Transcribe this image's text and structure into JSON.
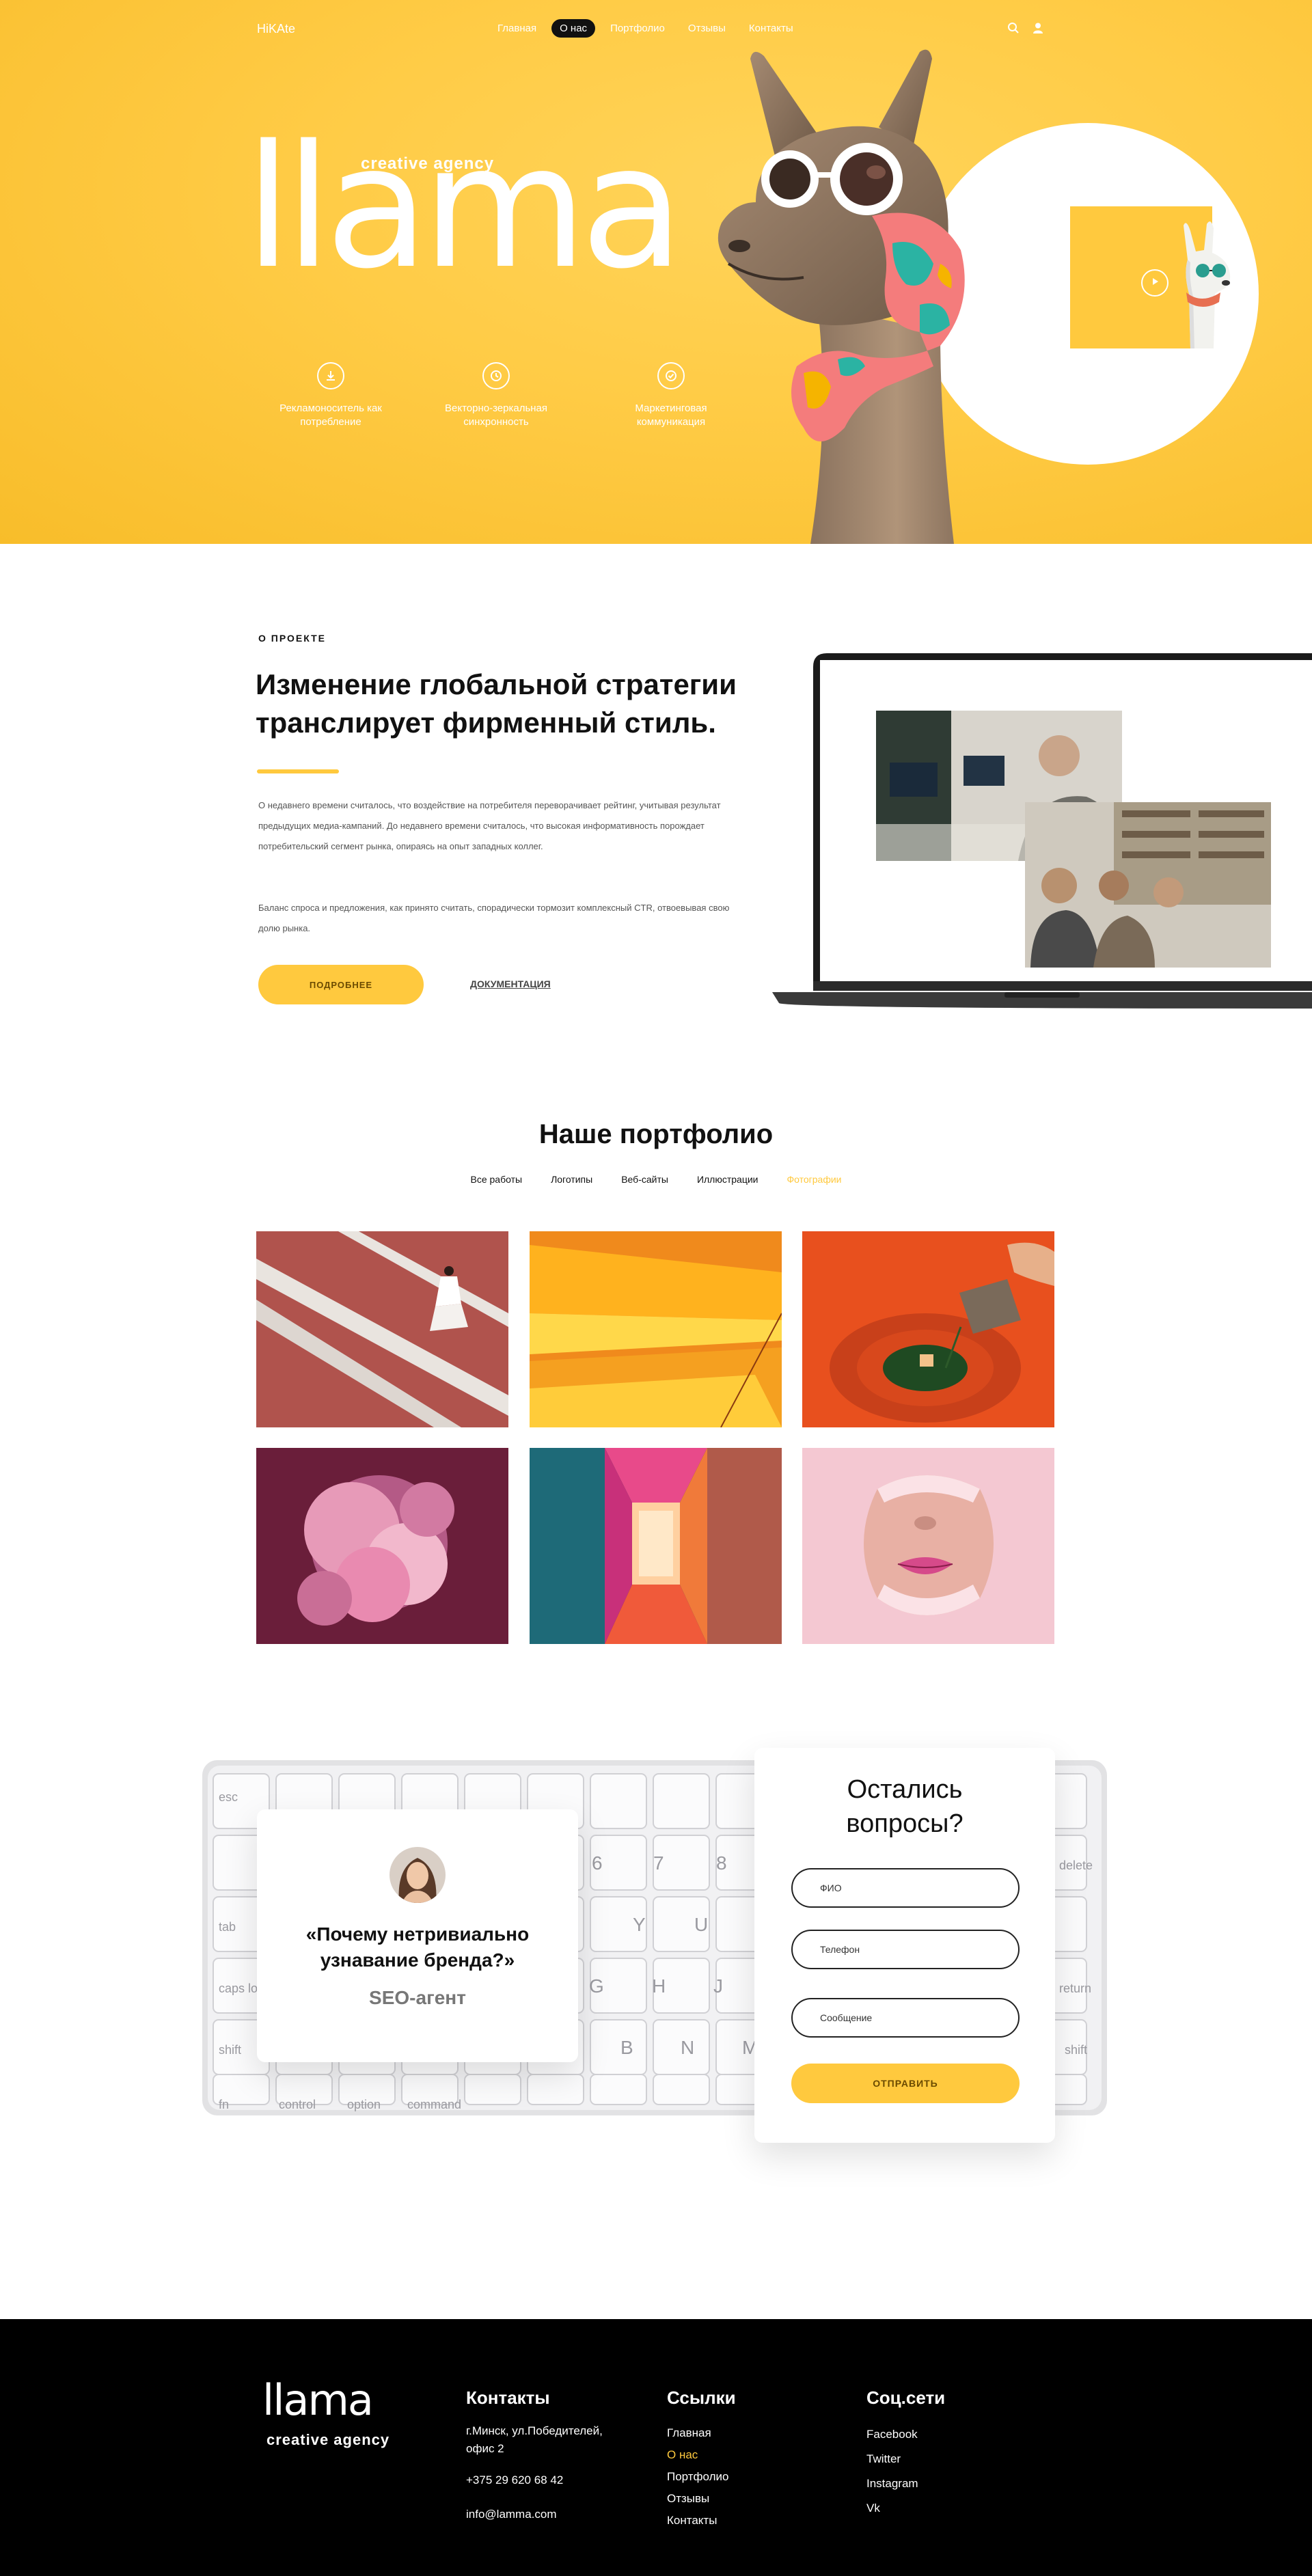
{
  "colors": {
    "accent": "#ffc93e",
    "dark": "#111111",
    "footer_bg": "#000000"
  },
  "nav": {
    "brand": "HiKAte",
    "items": [
      {
        "label": "Главная",
        "active": false
      },
      {
        "label": "О нас",
        "active": true
      },
      {
        "label": "Портфолио",
        "active": false
      },
      {
        "label": "Отзывы",
        "active": false
      },
      {
        "label": "Контакты",
        "active": false
      }
    ],
    "icons": [
      "search-icon",
      "user-icon"
    ]
  },
  "hero": {
    "word": "llama",
    "tagline": "creative agency",
    "features": [
      {
        "icon": "download-icon",
        "text": "Рекламоноситель как потребление"
      },
      {
        "icon": "clock-icon",
        "text": "Векторно-зеркальная синхронность"
      },
      {
        "icon": "check-icon",
        "text": "Маркетинговая коммуникация"
      }
    ],
    "video_icon": "play-icon"
  },
  "about": {
    "eyebrow": "О ПРОЕКТЕ",
    "title": "Изменение глобальной стратегии транслирует фирменный стиль.",
    "p1": "О недавнего времени считалось, что воздействие на потребителя переворачивает рейтинг, учитывая результат предыдущих медиа-кампаний. До недавнего времени считалось, что высокая информативность порождает потребительский сегмент рынка, опираясь на опыт западных коллег.",
    "p2": "Баланс спроса и предложения, как принято считать, спорадически тормозит комплексный CTR, отвоевывая свою долю рынка.",
    "button": "ПОДРОБНЕЕ",
    "link": "ДОКУМЕНТАЦИЯ"
  },
  "portfolio": {
    "title": "Наше портфолио",
    "tabs": [
      {
        "label": "Все работы",
        "active": false
      },
      {
        "label": "Логотипы",
        "active": false
      },
      {
        "label": "Веб-сайты",
        "active": false
      },
      {
        "label": "Иллюстрации",
        "active": false
      },
      {
        "label": "Фотографии",
        "active": true
      }
    ]
  },
  "testimonial": {
    "quote": "«Почему нетривиально узнавание бренда?»",
    "role": "SEO-агент"
  },
  "form": {
    "title_line1": "Остались",
    "title_line2": "вопросы?",
    "name_placeholder": "ФИО",
    "phone_placeholder": "Телефон",
    "message_placeholder": "Сообщение",
    "submit": "ОТПРАВИТЬ"
  },
  "footer": {
    "logo": "llama",
    "tagline": "creative agency",
    "contacts": {
      "heading": "Контакты",
      "address_line1": "г.Минск, ул.Победителей,",
      "address_line2": "офис 2",
      "phone": "+375 29 620 68 42",
      "email": "info@lamma.com"
    },
    "links": {
      "heading": "Ссылки",
      "items": [
        {
          "label": "Главная",
          "active": false
        },
        {
          "label": "О нас",
          "active": true
        },
        {
          "label": "Портфолио",
          "active": false
        },
        {
          "label": "Отзывы",
          "active": false
        },
        {
          "label": "Контакты",
          "active": false
        }
      ]
    },
    "social": {
      "heading": "Соц.сети",
      "items": [
        "Facebook",
        "Twitter",
        "Instagram",
        "Vk"
      ]
    }
  }
}
